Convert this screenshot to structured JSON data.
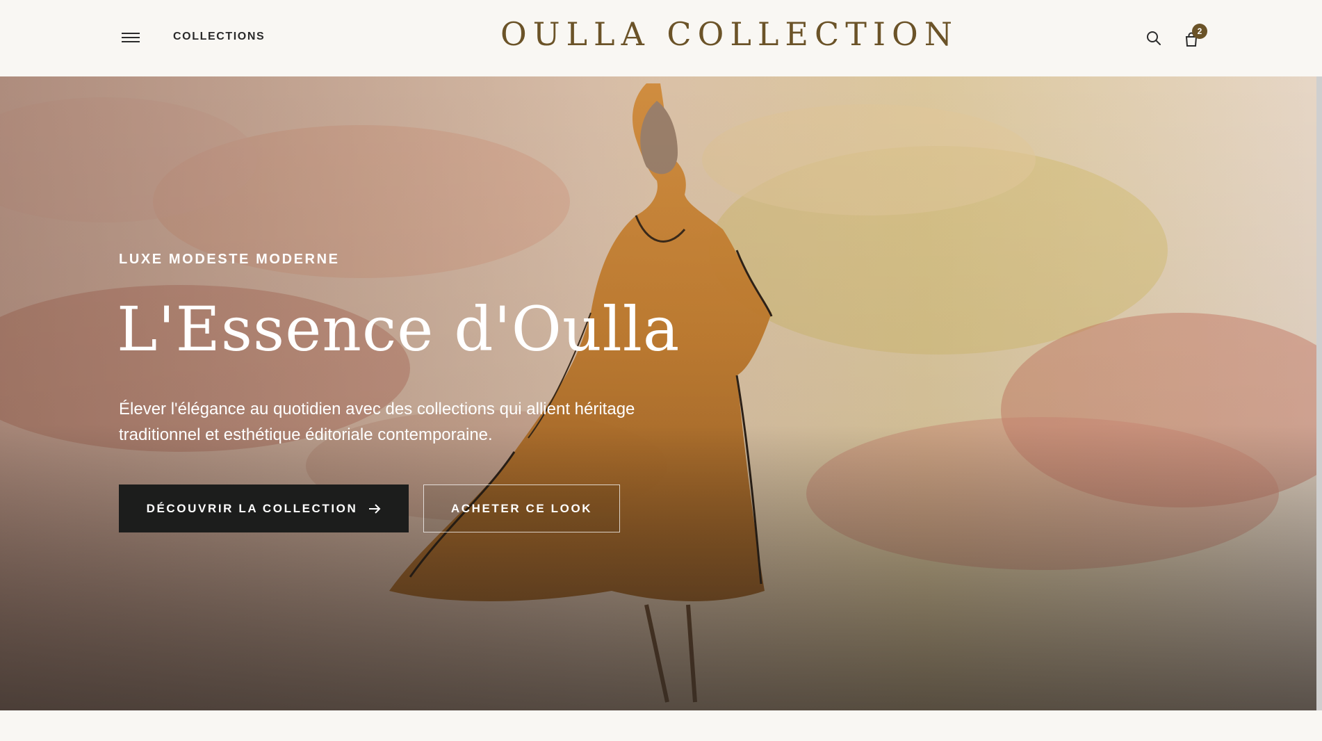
{
  "header": {
    "nav_label": "COLLECTIONS",
    "brand": "OULLA COLLECTION",
    "cart_count": "2"
  },
  "hero": {
    "eyebrow": "LUXE MODESTE MODERNE",
    "headline": "L'Essence d'Oulla",
    "subcopy": "Élever l'élégance au quotidien avec des collections qui allient héritage traditionnel et esthétique éditoriale contemporaine.",
    "primary_button": "DÉCOUVRIR LA COLLECTION",
    "secondary_button": "ACHETER CE LOOK"
  },
  "colors": {
    "brand": "#6b5328",
    "primary_button_bg": "#1c1d1c",
    "page_bg": "#f9f7f3"
  },
  "icons": [
    "menu-icon",
    "search-icon",
    "shopping-bag-icon",
    "arrow-right-icon"
  ]
}
